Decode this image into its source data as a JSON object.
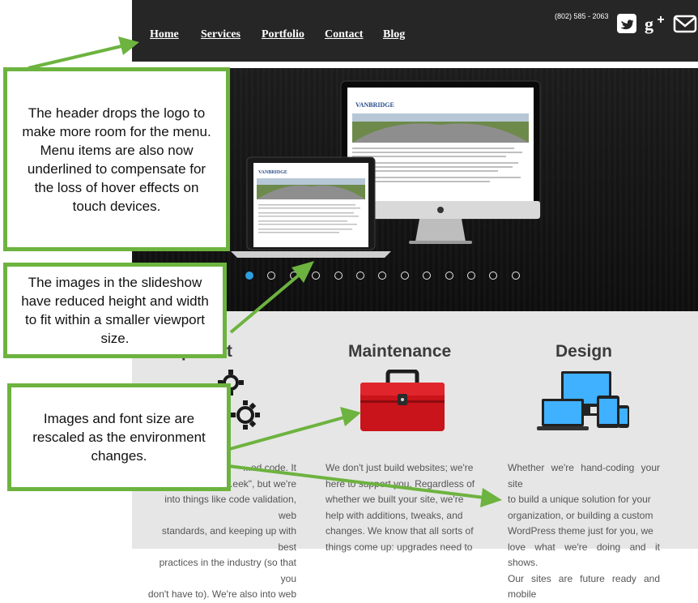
{
  "header": {
    "nav": [
      {
        "label": "Home",
        "id": "home"
      },
      {
        "label": "Services",
        "id": "services"
      },
      {
        "label": "Portfolio",
        "id": "portfolio"
      },
      {
        "label": "Contact",
        "id": "contact"
      },
      {
        "label": "Blog",
        "id": "blog"
      }
    ],
    "phone": "(802) 585 - 2063",
    "social_icons": [
      "twitter-icon",
      "google-plus-icon",
      "mail-icon"
    ]
  },
  "slideshow": {
    "brand": "VANBRIDGE",
    "slide_count": 13,
    "active_slide": 1,
    "active_color": "#2c9fe0"
  },
  "columns": [
    {
      "title": "Development",
      "text_lines": [
        "...ed code. It",
        "...eek\", but we're",
        "into things like code validation, web",
        "standards, and keeping up with best",
        "practices in the industry (so that you",
        "don't have to). We're also into web"
      ]
    },
    {
      "title": "Maintenance",
      "text_lines": [
        "We don't just build websites; we're",
        "here to support you. Regardless of",
        "whether we built your site, we're",
        "help with additions, tweaks, and",
        "changes. We know that all sorts of",
        "things come up: upgrades need to"
      ]
    },
    {
      "title": "Design",
      "text_lines": [
        "Whether we're hand-coding your site",
        "to build a unique solution for your",
        "organization, or building a custom",
        "WordPress theme just for you, we",
        "love what we're doing and it shows.",
        "Our sites are future ready and mobile"
      ]
    }
  ],
  "annotations": {
    "header_note": "The header drops the logo to make more room for the menu.  Menu items are also now underlined to compensate for the loss of hover effects on touch devices.",
    "slideshow_note": "The images in the slideshow have reduced height and width to fit within a smaller viewport size.",
    "rescale_note": "Images and font size are rescaled as the environment changes.",
    "accent_color": "#6db33f"
  }
}
